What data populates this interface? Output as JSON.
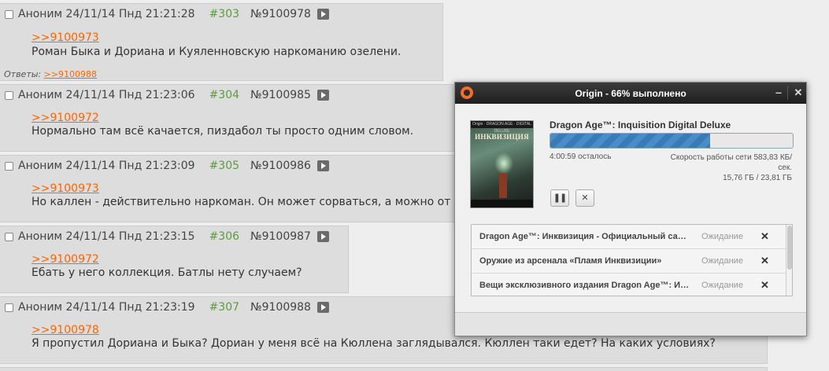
{
  "posts": [
    {
      "meta": "Аноним 24/11/14 Пнд 21:21:28",
      "num": "#303",
      "id": "№9100978",
      "reply": ">>9100973",
      "text": "Роман Быка и Дориана и Куяленновскую наркоманию озелени.",
      "answers_label": "Ответы:",
      "answers_link": ">>9100988"
    },
    {
      "meta": "Аноним 24/11/14 Пнд 21:23:06",
      "num": "#304",
      "id": "№9100985",
      "reply": ">>9100972",
      "text": "Нормально там всё качается, пиздабол ты просто одним словом."
    },
    {
      "meta": "Аноним 24/11/14 Пнд 21:23:09",
      "num": "#305",
      "id": "№9100986",
      "reply": ">>9100973",
      "text": "Но каллен - действительно наркоман. Он может сорваться, а можно от"
    },
    {
      "meta": "Аноним 24/11/14 Пнд 21:23:15",
      "num": "#306",
      "id": "№9100987",
      "reply": ">>9100972",
      "text": "Ебать у него коллекция. Батлы нету случаем?"
    },
    {
      "meta": "Аноним 24/11/14 Пнд 21:23:19",
      "num": "#307",
      "id": "№9100988",
      "reply": ">>9100978",
      "text": "Я пропустил Дориана и Быка? Дориан у меня всё на Кюллена заглядывался. Кюллен таки едет? На каких условиях?"
    }
  ],
  "dialog": {
    "title": "Origin - 66% выполнено",
    "minimize": "‒",
    "close": "✕",
    "cover_top": "Origin · DRAGON AGE · DIGITAL DELUXE",
    "cover_title": "ИНКВИЗИЦИЯ",
    "game_title": "Dragon Age™: Inquisition Digital Deluxe",
    "progress": 0.66,
    "remaining": "4:00:59 осталось",
    "speed": "Скорость работы сети 583,83 КБ/сек.",
    "size": "15,76 ГБ / 23,81 ГБ",
    "pause_label": "❚❚",
    "cancel_label": "✕",
    "queue": [
      {
        "name": "Dragon Age™: Инквизиция - Официальный саундтрек",
        "status": "Ожидание",
        "remove": "✕"
      },
      {
        "name": "Оружие из арсенала «Пламя Инквизиции»",
        "status": "Ожидание",
        "remove": "✕"
      },
      {
        "name": "Вещи эксклюзивного издания Dragon Age™: Инквизиция",
        "status": "Ожидание",
        "remove": "✕"
      }
    ]
  },
  "colors": {
    "accent_link": "#ff6600",
    "post_number": "#5c9c3c",
    "progress": "#4a8cc8",
    "origin_orange": "#f56c2d"
  }
}
